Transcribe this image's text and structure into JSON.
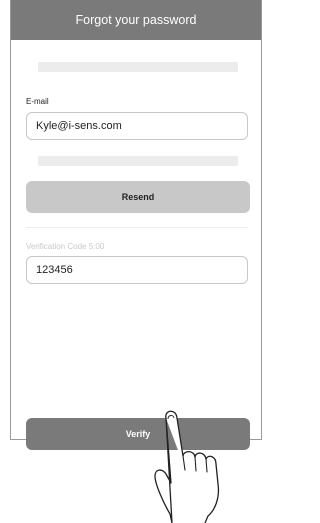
{
  "header": {
    "title": "Forgot your password"
  },
  "email": {
    "label": "E-mail",
    "value": "Kyle@i-sens.com"
  },
  "resend": {
    "label": "Resend"
  },
  "verification": {
    "label": "Verification Code 5:00",
    "value": "123456"
  },
  "verify": {
    "label": "Verify"
  },
  "icons": {
    "pointer": "tapping-hand-icon"
  },
  "colors": {
    "header_bg": "#7a7a7a",
    "resend_bg": "#c8c8c8",
    "verify_bg": "#7a7a7a"
  }
}
